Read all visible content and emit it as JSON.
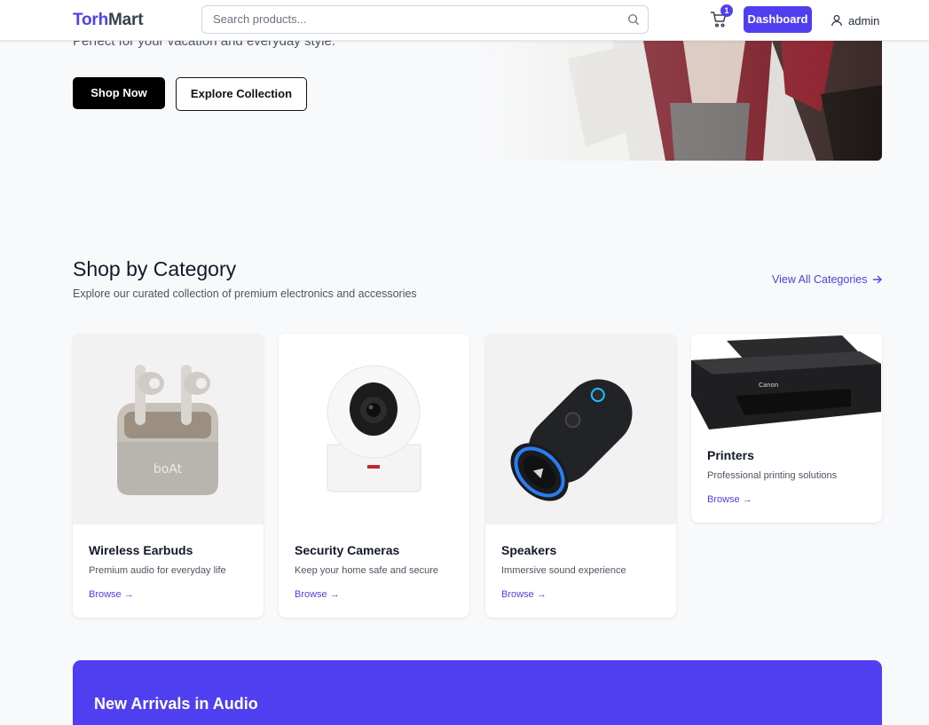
{
  "header": {
    "logo_part1": "Torh",
    "logo_part2": "Mart",
    "search_placeholder": "Search products...",
    "cart_count": "1",
    "dashboard_label": "Dashboard",
    "username": "admin",
    "accent_color": "#4f3ff0"
  },
  "hero": {
    "tagline": "Perfect for your vacation and everyday style.",
    "shop_now_label": "Shop Now",
    "explore_label": "Explore Collection"
  },
  "categories": {
    "title": "Shop by Category",
    "subtitle": "Explore our curated collection of premium electronics and accessories",
    "view_all_label": "View All Categories",
    "items": [
      {
        "name": "Wireless Earbuds",
        "desc": "Premium audio for everyday life",
        "browse": "Browse",
        "icon": "earbuds-image",
        "brand_mark": "boAt"
      },
      {
        "name": "Security Cameras",
        "desc": "Keep your home safe and secure",
        "browse": "Browse",
        "icon": "camera-image"
      },
      {
        "name": "Speakers",
        "desc": "Immersive sound experience",
        "browse": "Browse",
        "icon": "speaker-image"
      },
      {
        "name": "Printers",
        "desc": "Professional printing solutions",
        "browse": "Browse",
        "icon": "printer-image",
        "brand_mark": "Canon"
      }
    ]
  },
  "banner": {
    "title": "New Arrivals in Audio"
  }
}
